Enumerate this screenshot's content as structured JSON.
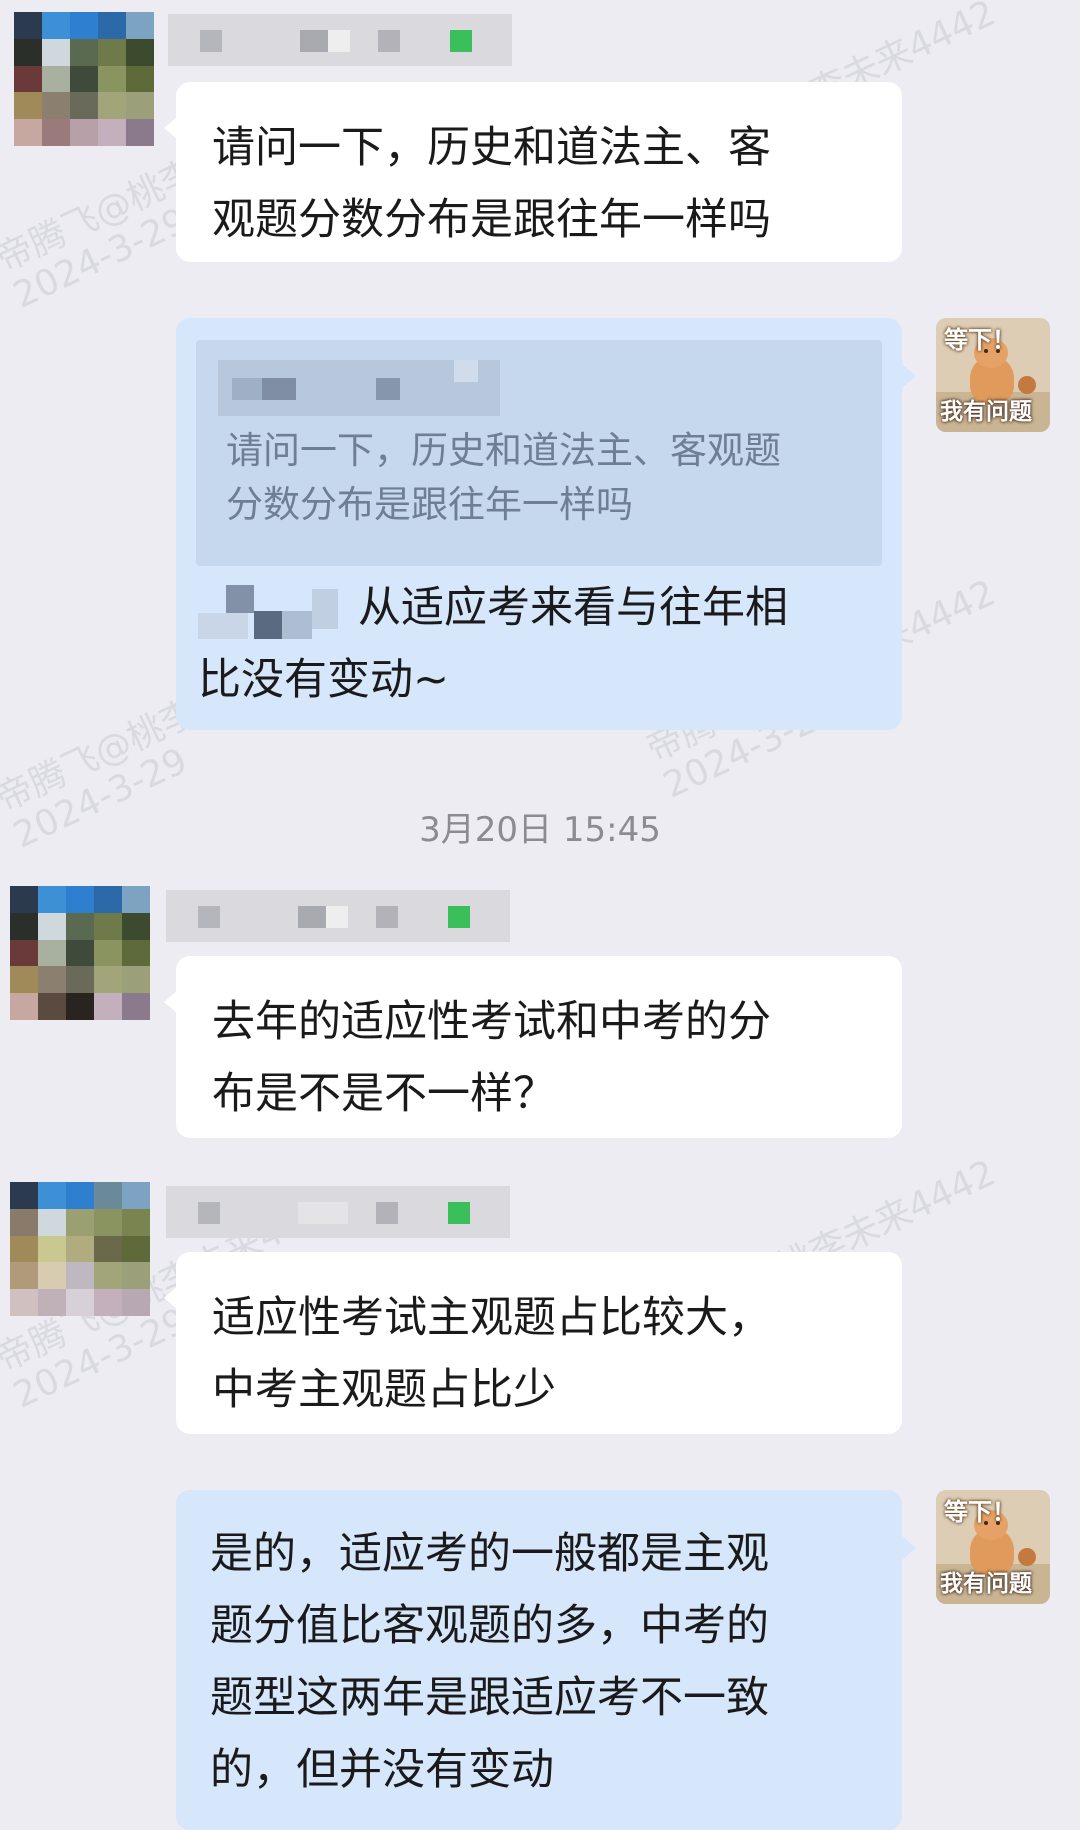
{
  "watermark": {
    "line1": "帝腾飞@桃李未来4442",
    "line2": "2024-3-29"
  },
  "messages": [
    {
      "id": "m1",
      "direction": "incoming",
      "text_lines": [
        "请问一下，历史和道法主、客",
        "观题分数分布是跟往年一样吗"
      ]
    },
    {
      "id": "m2",
      "direction": "outgoing",
      "quote_lines": [
        "请问一下，历史和道法主、客观题",
        "分数分布是跟往年一样吗"
      ],
      "text_lines": [
        "从适应考来看与往年相",
        "比没有变动~"
      ],
      "avatar_sticker": {
        "top": "等下！",
        "bottom": "我有问题"
      }
    },
    {
      "id": "m3",
      "direction": "incoming",
      "text_lines": [
        "去年的适应性考试和中考的分",
        "布是不是不一样？"
      ]
    },
    {
      "id": "m4",
      "direction": "incoming",
      "text_lines": [
        "适应性考试主观题占比较大，",
        "中考主观题占比少"
      ]
    },
    {
      "id": "m5",
      "direction": "outgoing",
      "text_lines": [
        "是的，适应考的一般都是主观",
        "题分值比客观题的多，中考的",
        "题型这两年是跟适应考不一致",
        "的，但并没有变动"
      ],
      "avatar_sticker": {
        "top": "等下！",
        "bottom": "我有问题"
      }
    }
  ],
  "timestamp": "3月20日  15:45"
}
